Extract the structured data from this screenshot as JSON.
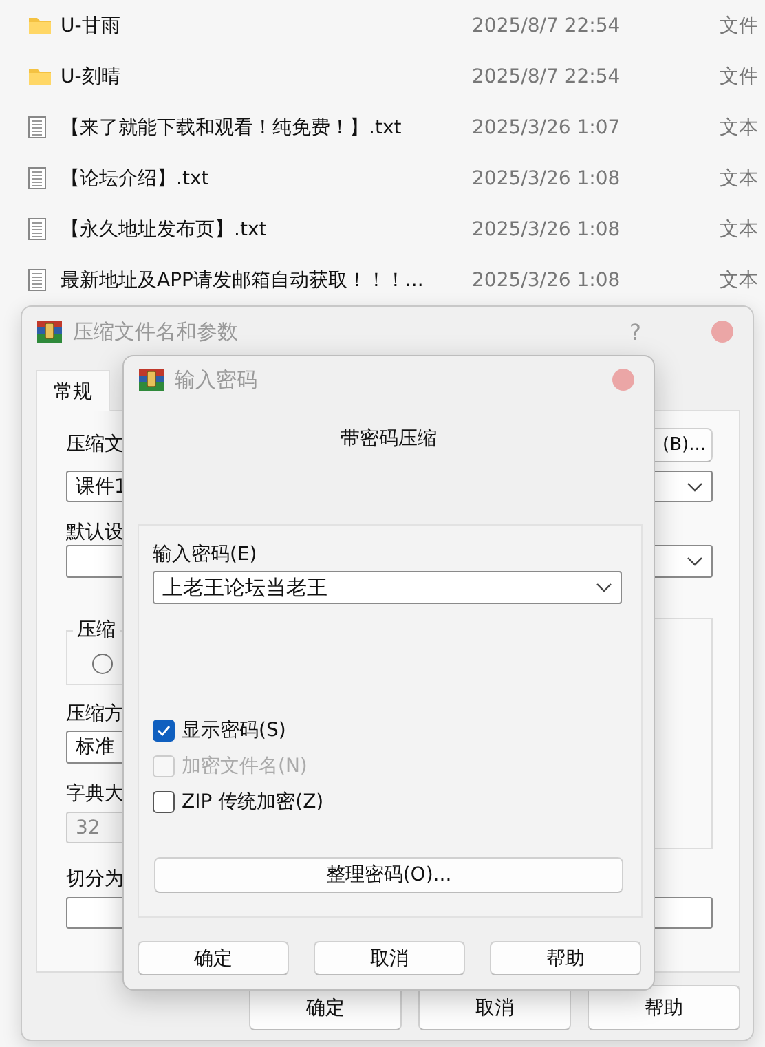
{
  "file_list": [
    {
      "kind": "folder",
      "name": "U-甘雨",
      "date": "2025/8/7 22:54",
      "type": "文件"
    },
    {
      "kind": "folder",
      "name": "U-刻晴",
      "date": "2025/8/7 22:54",
      "type": "文件"
    },
    {
      "kind": "text",
      "name": "【来了就能下载和观看！纯免费！】.txt",
      "date": "2025/3/26 1:07",
      "type": "文本"
    },
    {
      "kind": "text",
      "name": "【论坛介绍】.txt",
      "date": "2025/3/26 1:08",
      "type": "文本"
    },
    {
      "kind": "text",
      "name": "【永久地址发布页】.txt",
      "date": "2025/3/26 1:08",
      "type": "文本"
    },
    {
      "kind": "text",
      "name": "最新地址及APP请发邮箱自动获取！！！...",
      "date": "2025/3/26 1:08",
      "type": "文本"
    }
  ],
  "archive_dialog": {
    "title": "压缩文件名和参数",
    "help": "?",
    "tabs": [
      {
        "label": "常规",
        "selected": true
      }
    ],
    "archive_name_label": "压缩文",
    "browse_button": "(B)...",
    "archive_name": "课件1",
    "profile_label": "默认设",
    "format_group_label": "压缩",
    "format_radio": {
      "selected": false
    },
    "method_label": "压缩方",
    "method": "标准",
    "dictionary_label": "字典大",
    "dictionary": {
      "value": "32",
      "disabled": true
    },
    "split_label": "切分为",
    "buttons": [
      "确定",
      "取消",
      "帮助"
    ]
  },
  "password_dialog": {
    "title": "输入密码",
    "heading": "带密码压缩",
    "password_label": "输入密码(E)",
    "password": "上老王论坛当老王",
    "options": [
      {
        "label": "显示密码(S)",
        "checked": true,
        "disabled": false
      },
      {
        "label": "加密文件名(N)",
        "checked": false,
        "disabled": true
      },
      {
        "label": "ZIP 传统加密(Z)",
        "checked": false,
        "disabled": false
      }
    ],
    "organize_button": "整理密码(O)...",
    "buttons": [
      "确定",
      "取消",
      "帮助"
    ]
  }
}
